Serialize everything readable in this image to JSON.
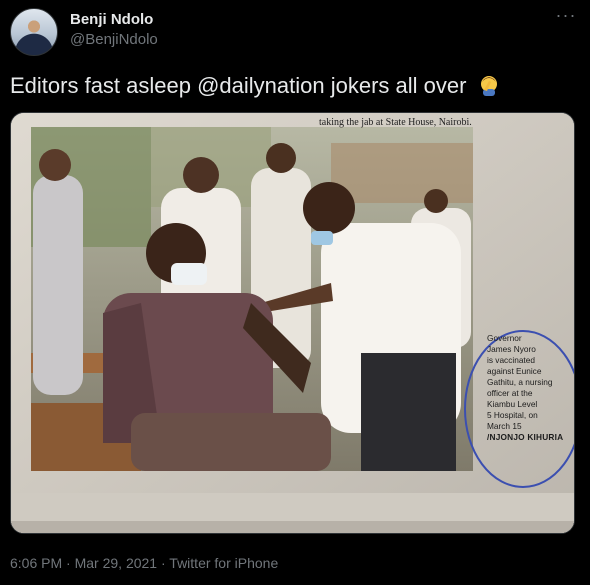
{
  "author": {
    "display_name": "Benji Ndolo",
    "handle": "@BenjiNdolo"
  },
  "tweet": {
    "text": "Editors fast asleep @dailynation jokers all over",
    "emoji": "man-facepalming-emoji"
  },
  "media": {
    "top_caption": "taking the jab at State House, Nairobi.",
    "side_caption_lines": [
      "Governor",
      "James Nyoro",
      "is vaccinated",
      "against Eunice",
      "Gathitu, a nursing",
      "officer at the",
      "Kiambu Level",
      "5 Hospital, on",
      "March 15"
    ],
    "photo_credit": "/NJONJO KIHURIA"
  },
  "footer": {
    "time": "6:06 PM",
    "separator": " · ",
    "date": "Mar 29, 2021",
    "source": "Twitter for iPhone"
  },
  "colors": {
    "background": "#000000",
    "primary_text": "#e7e9ea",
    "secondary_text": "#71767b",
    "annotation_circle": "#3b4fb0"
  },
  "icons": {
    "more": "more-options-icon"
  }
}
